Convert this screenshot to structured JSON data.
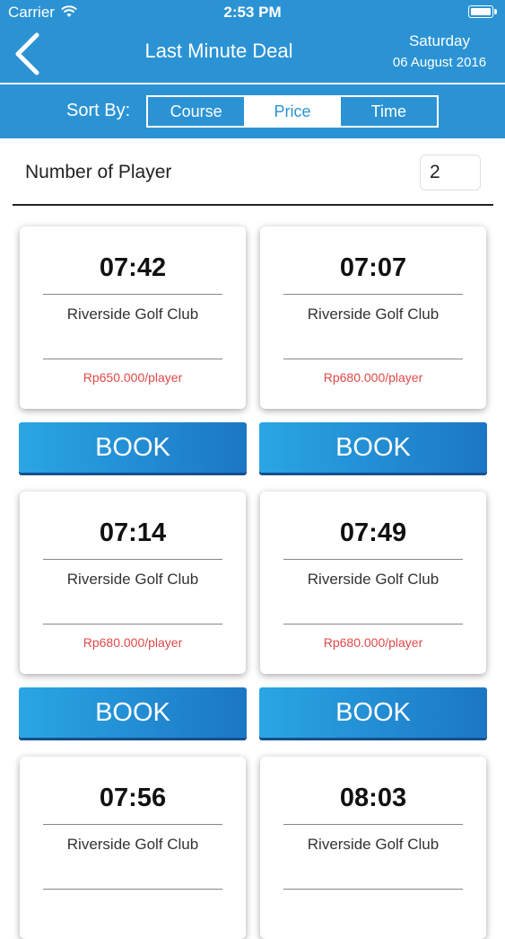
{
  "status_bar": {
    "carrier": "Carrier",
    "time": "2:53 PM"
  },
  "nav": {
    "title": "Last Minute Deal",
    "day": "Saturday",
    "date": "06 August 2016"
  },
  "sort": {
    "label": "Sort By:",
    "options": [
      "Course",
      "Price",
      "Time"
    ],
    "selected": "Price"
  },
  "players": {
    "label": "Number of Player",
    "value": "2"
  },
  "deals": [
    {
      "time": "07:42",
      "club": "Riverside Golf Club",
      "price": "Rp650.000/player",
      "book_label": "BOOK"
    },
    {
      "time": "07:07",
      "club": "Riverside Golf Club",
      "price": "Rp680.000/player",
      "book_label": "BOOK"
    },
    {
      "time": "07:14",
      "club": "Riverside Golf Club",
      "price": "Rp680.000/player",
      "book_label": "BOOK"
    },
    {
      "time": "07:49",
      "club": "Riverside Golf Club",
      "price": "Rp680.000/player",
      "book_label": "BOOK"
    },
    {
      "time": "07:56",
      "club": "Riverside Golf Club"
    },
    {
      "time": "08:03",
      "club": "Riverside Golf Club"
    }
  ],
  "colors": {
    "primary": "#2b93d4",
    "price": "#e04848",
    "button_dark": "#1c76c4"
  },
  "icons": {
    "back": "chevron-left-icon",
    "wifi": "wifi-icon",
    "battery": "battery-icon"
  }
}
